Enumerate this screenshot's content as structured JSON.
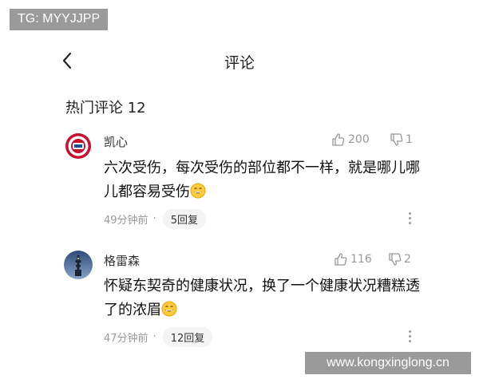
{
  "watermark_top": "TG: MYYJJPP",
  "watermark_bottom": "www.kongxinglong.cn",
  "header": {
    "title": "评论"
  },
  "section": {
    "title": "热门评论 12"
  },
  "comments": [
    {
      "user": "凯心",
      "likes": "200",
      "dislikes": "1",
      "text": "六次受伤，每次受伤的部位都不一样，就是哪儿哪儿都容易受伤",
      "time": "49分钟前",
      "replies": "5回复"
    },
    {
      "user": "格雷森",
      "likes": "116",
      "dislikes": "2",
      "text": "怀疑东契奇的健康状况，换了一个健康状况糟糕透了的浓眉",
      "time": "47分钟前",
      "replies": "12回复"
    }
  ],
  "colors": {
    "text": "#111111",
    "muted": "#999999",
    "pill": "#f4f4f4",
    "watermark": "#9a9a9a"
  }
}
